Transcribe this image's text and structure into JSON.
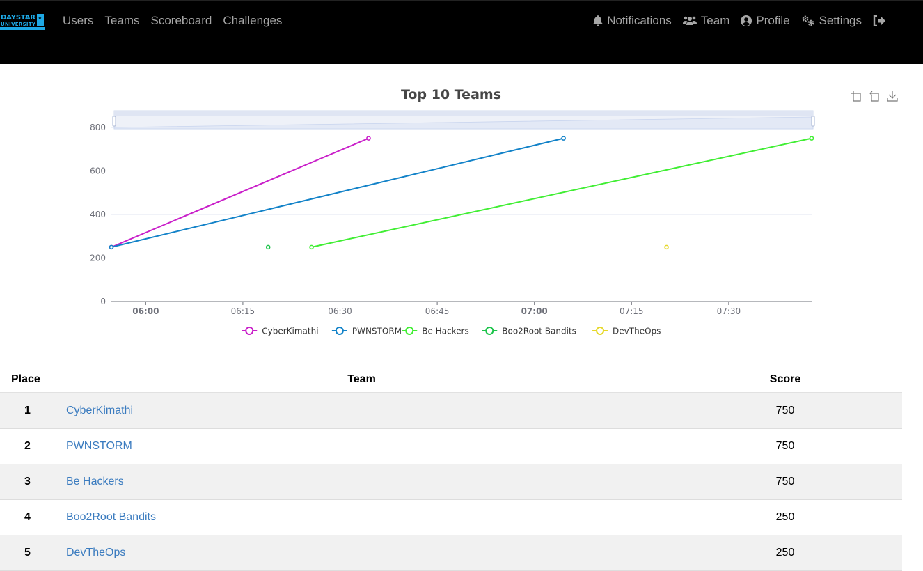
{
  "navbar": {
    "logo_alt": "DAYSTAR UNIVERSITY",
    "left_links": [
      {
        "label": "Users"
      },
      {
        "label": "Teams"
      },
      {
        "label": "Scoreboard"
      },
      {
        "label": "Challenges"
      }
    ],
    "right_links": [
      {
        "label": "Notifications",
        "icon": "bell-icon"
      },
      {
        "label": "Team",
        "icon": "users-icon"
      },
      {
        "label": "Profile",
        "icon": "user-circle-icon"
      },
      {
        "label": "Settings",
        "icon": "cogs-icon"
      },
      {
        "label": "",
        "icon": "logout-icon"
      }
    ]
  },
  "toolbox": [
    "zoom-icon",
    "zoom-reset-icon",
    "download-icon"
  ],
  "chart_data": {
    "type": "line",
    "title": "Top 10 Teams",
    "xlabel": "",
    "ylabel": "",
    "ylim": [
      0,
      800
    ],
    "yticks": [
      0,
      200,
      400,
      600,
      800
    ],
    "xrange": [
      "05:54.7",
      "07:42.8"
    ],
    "xticks": [
      {
        "label": "06:00",
        "bold": true,
        "min": 360
      },
      {
        "label": "06:15",
        "bold": false,
        "min": 375
      },
      {
        "label": "06:30",
        "bold": false,
        "min": 390
      },
      {
        "label": "06:45",
        "bold": false,
        "min": 405
      },
      {
        "label": "07:00",
        "bold": true,
        "min": 420
      },
      {
        "label": "07:15",
        "bold": false,
        "min": 435
      },
      {
        "label": "07:30",
        "bold": false,
        "min": 450
      }
    ],
    "xmin_min": 354.7,
    "xmax_min": 462.8,
    "grid": true,
    "legend": "bottom-center",
    "series": [
      {
        "name": "CyberKimathi",
        "color": "#c91fc9",
        "points": [
          [
            354.7,
            250
          ],
          [
            394.4,
            750
          ]
        ]
      },
      {
        "name": "PWNSTORM",
        "color": "#1282c8",
        "points": [
          [
            354.7,
            250
          ],
          [
            424.5,
            750
          ]
        ]
      },
      {
        "name": "Be Hackers",
        "color": "#40ee33",
        "points": [
          [
            385.6,
            250
          ],
          [
            462.8,
            750
          ]
        ]
      },
      {
        "name": "Boo2Root Bandits",
        "color": "#1cc44a",
        "points": [
          [
            378.9,
            250
          ]
        ]
      },
      {
        "name": "DevTheOps",
        "color": "#e6d829",
        "points": [
          [
            440.4,
            250
          ]
        ]
      }
    ]
  },
  "table": {
    "headers": {
      "place": "Place",
      "team": "Team",
      "score": "Score"
    },
    "rows": [
      {
        "place": "1",
        "team": "CyberKimathi",
        "score": "750"
      },
      {
        "place": "2",
        "team": "PWNSTORM",
        "score": "750"
      },
      {
        "place": "3",
        "team": "Be Hackers",
        "score": "750"
      },
      {
        "place": "4",
        "team": "Boo2Root Bandits",
        "score": "250"
      },
      {
        "place": "5",
        "team": "DevTheOps",
        "score": "250"
      }
    ]
  }
}
